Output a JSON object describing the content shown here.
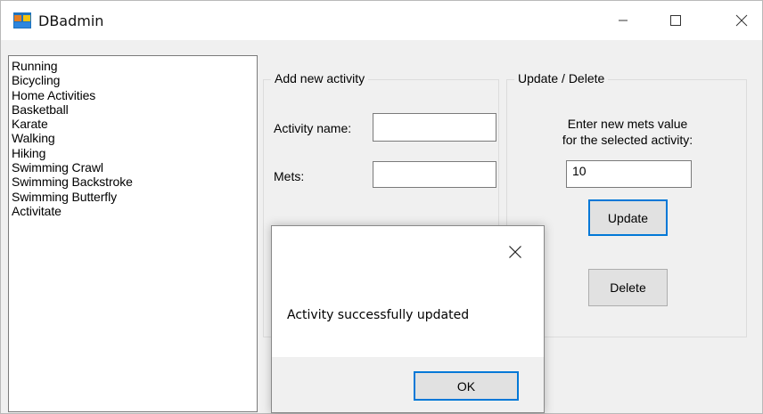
{
  "window": {
    "title": "DBadmin",
    "app_icon": "winforms-app-icon"
  },
  "activity_list": [
    "Running",
    "Bicycling",
    "Home Activities",
    "Basketball",
    "Karate",
    "Walking",
    "Hiking",
    "Swimming Crawl",
    "Swimming Backstroke",
    "Swimming Butterfly",
    "Activitate"
  ],
  "add_group": {
    "title": "Add new activity",
    "name_label": "Activity name:",
    "name_value": "",
    "mets_label": "Mets:",
    "mets_value": ""
  },
  "update_group": {
    "title": "Update / Delete",
    "hint_line1": "Enter new mets value",
    "hint_line2": "for the selected activity:",
    "mets_value": "10",
    "update_label": "Update",
    "delete_label": "Delete"
  },
  "dialog": {
    "message": "Activity successfully updated",
    "ok_label": "OK"
  },
  "colors": {
    "focus": "#0078d7",
    "icon_orange": "#e67e22",
    "icon_blue": "#1e73be"
  }
}
